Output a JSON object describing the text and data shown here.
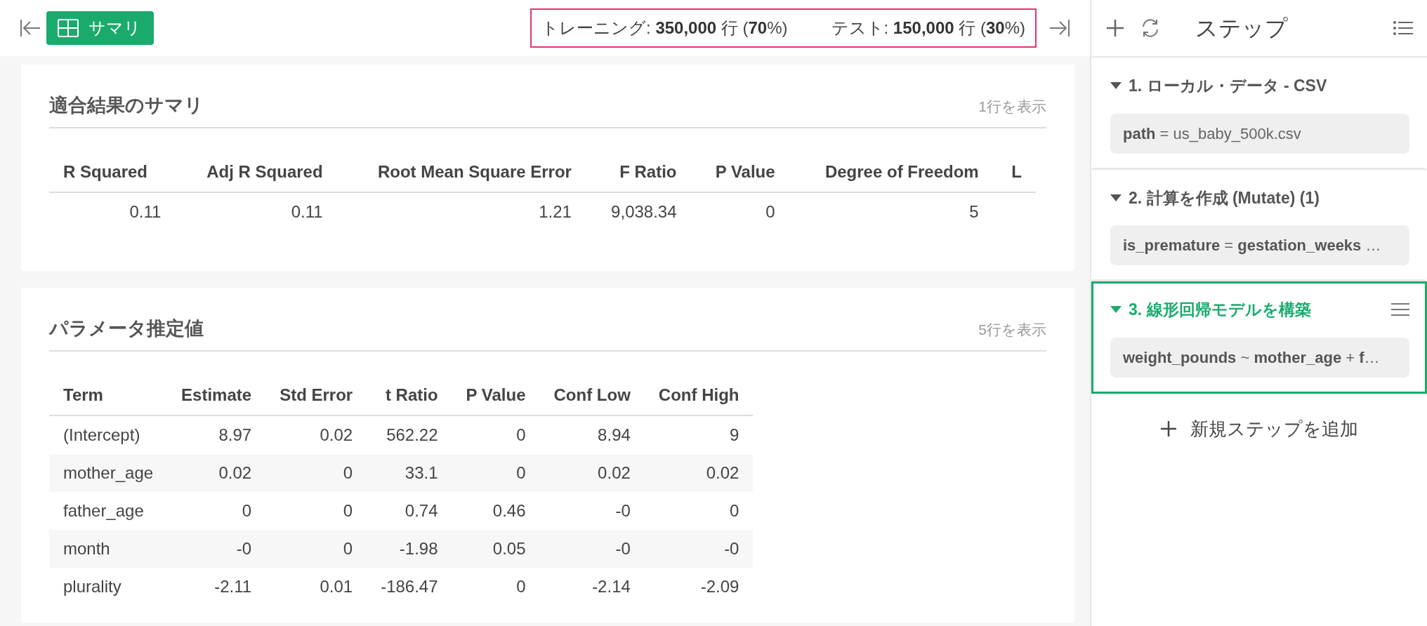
{
  "toolbar": {
    "summary_button": "サマリ",
    "split_info": [
      "トレーニング: **350,000** 行 (**70**%)",
      "テスト: **150,000** 行 (**30**%)"
    ]
  },
  "cards": [
    {
      "title": "適合結果のサマリ",
      "row_count": "1行を表示",
      "striped": false,
      "columns": [
        "R Squared",
        "Adj R Squared",
        "Root Mean Square Error",
        "F Ratio",
        "P Value",
        "Degree of Freedom",
        "L"
      ],
      "rows": [
        [
          "0.11",
          "0.11",
          "1.21",
          "9,038.34",
          "0",
          "5",
          ""
        ]
      ]
    },
    {
      "title": "パラメータ推定値",
      "row_count": "5行を表示",
      "striped": true,
      "columns": [
        "Term",
        "Estimate",
        "Std Error",
        "t Ratio",
        "P Value",
        "Conf Low",
        "Conf High"
      ],
      "rows": [
        [
          "(Intercept)",
          "8.97",
          "0.02",
          "562.22",
          "0",
          "8.94",
          "9"
        ],
        [
          "mother_age",
          "0.02",
          "0",
          "33.1",
          "0",
          "0.02",
          "0.02"
        ],
        [
          "father_age",
          "0",
          "0",
          "0.74",
          "0.46",
          "-0",
          "0"
        ],
        [
          "month",
          "-0",
          "0",
          "-1.98",
          "0.05",
          "-0",
          "-0"
        ],
        [
          "plurality",
          "-2.11",
          "0.01",
          "-186.47",
          "0",
          "-2.14",
          "-2.09"
        ]
      ]
    }
  ],
  "steps_panel": {
    "title": "ステップ",
    "steps": [
      {
        "title": "1. ローカル・データ - CSV",
        "detail": "**path** = us_baby_500k.csv",
        "selected": false
      },
      {
        "title": "2. 計算を作成 (Mutate) (1)",
        "detail": "**is_premature** = **gestation_weeks** …",
        "selected": false
      },
      {
        "title": "3. 線形回帰モデルを構築",
        "detail": "**weight_pounds** ~ **mother_age** + **f**…",
        "selected": true
      }
    ],
    "add_step": "新規ステップを追加"
  }
}
